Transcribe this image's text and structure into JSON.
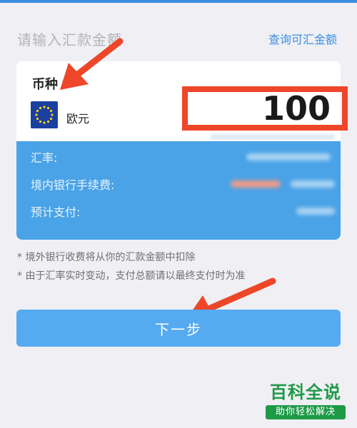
{
  "header": {
    "title": "请输入汇款金额",
    "link_label": "查询可汇金额"
  },
  "currency": {
    "label": "币种",
    "selected": "欧元",
    "flag_icon": "eu-flag-icon"
  },
  "amount": {
    "value": "100"
  },
  "details": {
    "rate_label": "汇率:",
    "fee_label": "境内银行手续费:",
    "total_label": "预计支付:"
  },
  "notes": [
    "* 境外银行收费将从你的汇款金额中扣除",
    "* 由于汇率实时变动，支付总额请以最终支付时为准"
  ],
  "next_button_label": "下一步",
  "watermark": {
    "title": "百科全说",
    "subtitle": "助你轻松解决"
  },
  "colors": {
    "accent": "#3a8fe0",
    "card_bottom": "#4aa3e6",
    "button": "#55aaf0",
    "annotation_red": "#ee4628",
    "watermark_green": "#1e9a47"
  }
}
